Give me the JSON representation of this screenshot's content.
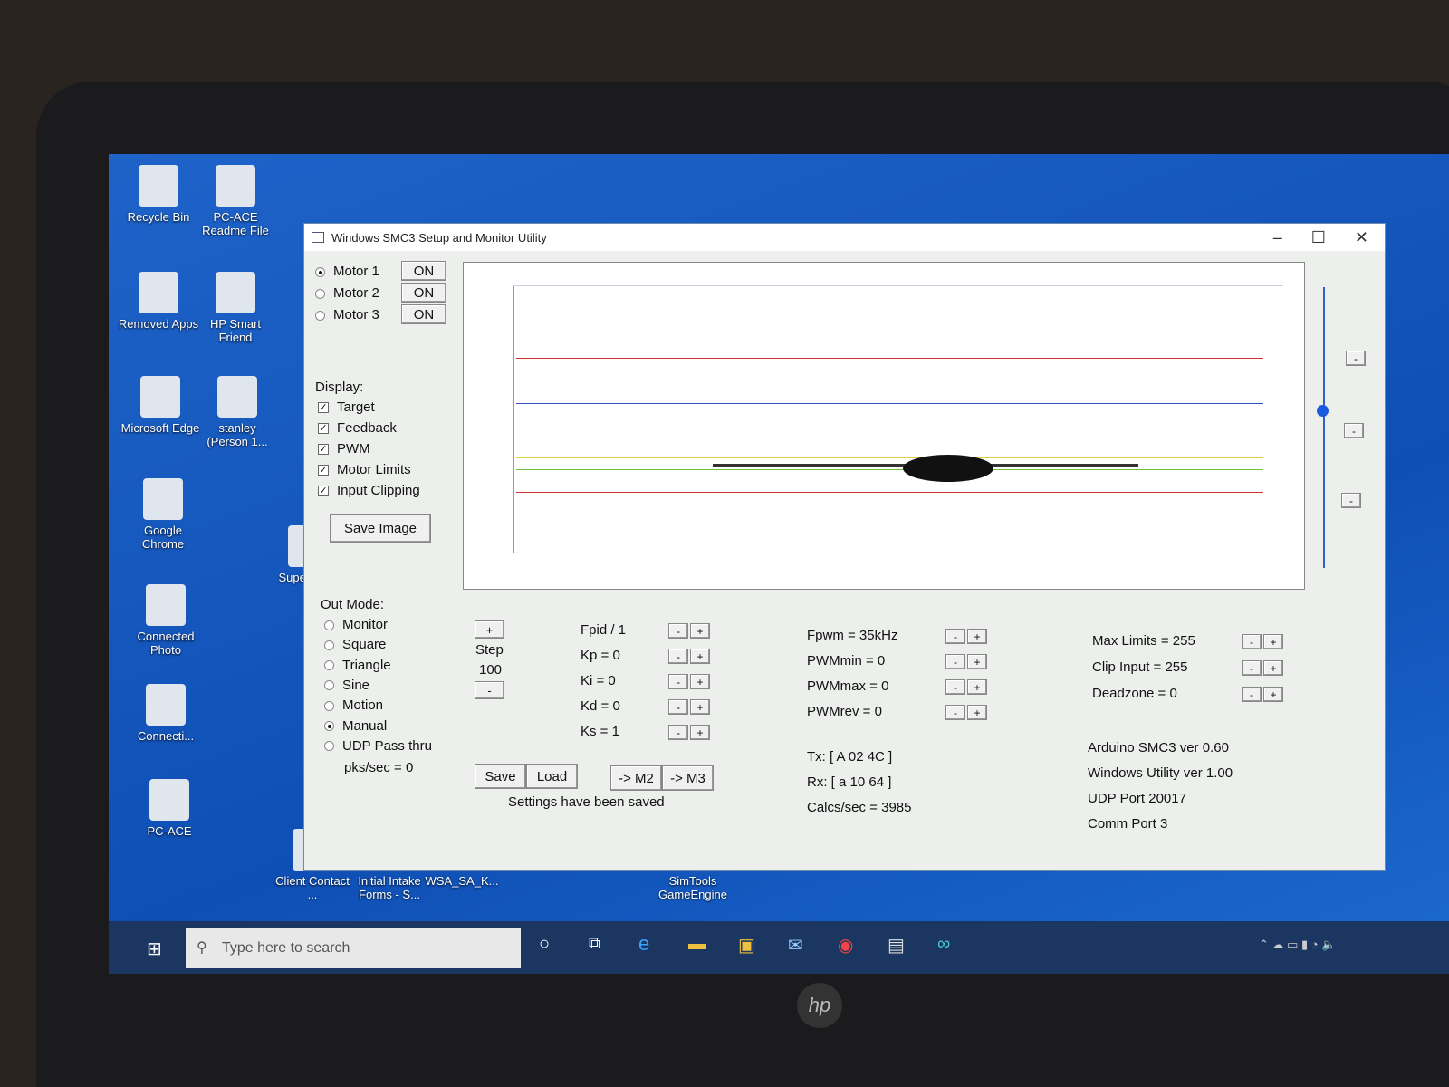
{
  "desktop": {
    "icons": [
      "Recycle Bin",
      "PC-ACE Readme File",
      "Removed Apps",
      "HP Smart Friend",
      "Microsoft Edge",
      "stanley (Person 1...",
      "Google Chrome",
      "Connected Photo",
      "Connecti...",
      "PC-ACE",
      "Supe Licen",
      "Client Contact ...",
      "Initial Intake Forms - S...",
      "WSA_SA_K...",
      "SimTools GameEngine"
    ]
  },
  "window": {
    "title": "Windows SMC3 Setup and Monitor Utility"
  },
  "motors": [
    {
      "label": "Motor 1",
      "btn": "ON",
      "selected": true
    },
    {
      "label": "Motor 2",
      "btn": "ON",
      "selected": false
    },
    {
      "label": "Motor 3",
      "btn": "ON",
      "selected": false
    }
  ],
  "display": {
    "heading": "Display:",
    "items": [
      "Target",
      "Feedback",
      "PWM",
      "Motor Limits",
      "Input Clipping"
    ],
    "save_image": "Save Image"
  },
  "out_mode": {
    "heading": "Out Mode:",
    "items": [
      "Monitor",
      "Square",
      "Triangle",
      "Sine",
      "Motion",
      "Manual",
      "UDP Pass thru"
    ],
    "selected": "Manual",
    "pks": "pks/sec = 0"
  },
  "step": {
    "plus": "+",
    "label": "Step",
    "value": "100",
    "minus": "-"
  },
  "pid": [
    "Fpid / 1",
    "Kp = 0",
    "Ki = 0",
    "Kd = 0",
    "Ks = 1"
  ],
  "pwm": [
    "Fpwm = 35kHz",
    "PWMmin = 0",
    "PWMmax = 0",
    "PWMrev = 0"
  ],
  "limits": [
    "Max Limits = 255",
    "Clip Input = 255",
    "Deadzone = 0"
  ],
  "buttons": {
    "save": "Save",
    "load": "Load",
    "m2": "-> M2",
    "m3": "-> M3",
    "minus": "-",
    "plus": "+"
  },
  "status": "Settings have been saved",
  "comms": {
    "tx": "Tx: [ A 02 4C ]",
    "rx": "Rx: [ a 10 64 ]",
    "calcs": "Calcs/sec = 3985"
  },
  "info": [
    "Arduino SMC3 ver 0.60",
    "Windows Utility ver 1.00",
    "UDP Port 20017",
    "Comm Port 3"
  ],
  "taskbar": {
    "search_placeholder": "Type here to search"
  },
  "colors": {
    "target": "#d03030",
    "feedback": "#3050c0",
    "pwm": "#e0d040",
    "limits": "#70c040"
  }
}
